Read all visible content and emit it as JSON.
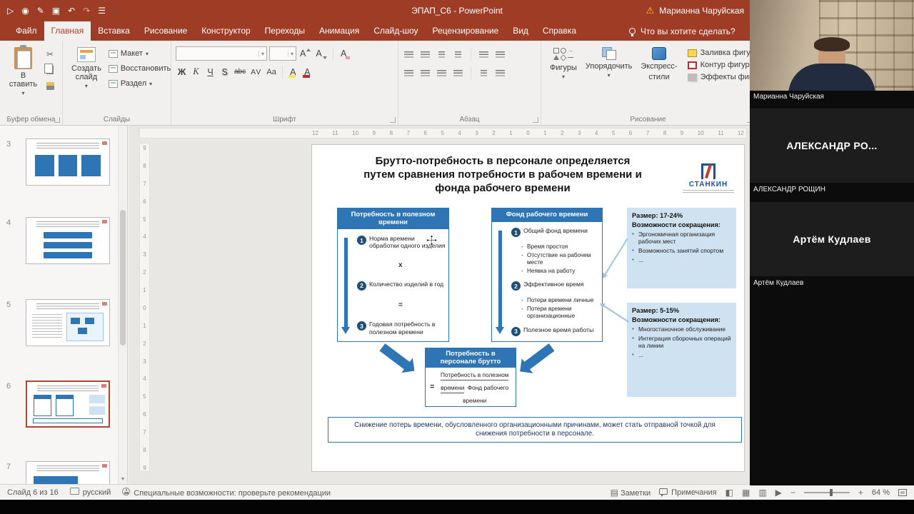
{
  "colors": {
    "ppt_red": "#9e3c26",
    "accent_blue": "#2e75b6",
    "dark_blue": "#1f4e79",
    "light_blue_fill": "#cfe2f1",
    "selected_thumb_border": "#b3432b",
    "warning_yellow": "#f6c61e"
  },
  "icons": {
    "caret": "▾",
    "scissors": "✂",
    "undo": "↶",
    "redo": "↷",
    "save": "▣",
    "slideshow": "▷",
    "touch": "◉",
    "pen": "✎",
    "menu": "☰",
    "warning": "⚠",
    "notes": "▤",
    "normal_view": "◧",
    "grid_view": "▦",
    "reading_view": "▥",
    "slideshow_view": "▶",
    "zoom_out": "−",
    "zoom_in": "+",
    "down_arrow": "▼"
  },
  "titlebar": {
    "title": "ЭПАП_С6 - PowerPoint",
    "account_name": "Марианна Чаруйская"
  },
  "tabs": {
    "file": "Файл",
    "active": "Главная",
    "rest": [
      "Вставка",
      "Рисование",
      "Конструктор",
      "Переходы",
      "Анимация",
      "Слайд-шоу",
      "Рецензирование",
      "Вид",
      "Справка"
    ],
    "tellme": "Что вы хотите сделать?"
  },
  "ribbon": {
    "paste": "В ставить",
    "new_slide": "Создать слайд",
    "layout": "Макет",
    "reset": "Восстановить",
    "section": "Раздел",
    "font": {
      "grow": "А",
      "shrink": "А",
      "clear": "А",
      "bold": "Ж",
      "italic": "К",
      "underline": "Ч",
      "shadow": "S",
      "strikethrough": "abc",
      "spacing": "AV",
      "case": "Aa",
      "highlight": "А",
      "color": "А"
    },
    "shapes": "Фигуры",
    "arrange": "Упорядочить",
    "quick_styles_1": "Экспресс-",
    "quick_styles_2": "стили",
    "shape_fill": "Заливка фигуры",
    "shape_outline": "Контур фигуры",
    "shape_effects": "Эффекты фигур",
    "groups": [
      "Буфер обмена",
      "Слайды",
      "Шрифт",
      "Абзац",
      "Рисование"
    ]
  },
  "thumbs": [
    {
      "num": "3"
    },
    {
      "num": "4"
    },
    {
      "num": "5"
    },
    {
      "num": "6"
    },
    {
      "num": "7"
    }
  ],
  "editor": {
    "hruler": [
      "12",
      "11",
      "10",
      "9",
      "8",
      "7",
      "6",
      "5",
      "4",
      "3",
      "2",
      "1",
      "0",
      "1",
      "2",
      "3",
      "4",
      "5",
      "6",
      "7",
      "8",
      "9",
      "10",
      "11",
      "12"
    ],
    "vruler": [
      "9",
      "8",
      "7",
      "6",
      "5",
      "4",
      "3",
      "2",
      "1",
      "0",
      "1",
      "2",
      "3",
      "4",
      "5",
      "6",
      "7",
      "8",
      "9"
    ]
  },
  "slide": {
    "title_lines": [
      "Брутто-потребность в персонале определяется",
      "путем сравнения потребности в рабочем времени и",
      "фонда рабочего времени"
    ],
    "logo_text": "СТАНКИН",
    "left_box": {
      "header": "Потребность в полезном времени",
      "steps": [
        {
          "num": "1",
          "text": "Норма времени обработки одного изделия"
        },
        {
          "num": "2",
          "text": "Количество изделий в год"
        },
        {
          "num": "3",
          "text": "Годовая потребность в полезном времени"
        }
      ],
      "multiply": "х",
      "equals": "="
    },
    "middle_box": {
      "header": "Фонд рабочего времени",
      "step1": {
        "num": "1",
        "text": "Общий фонд времени"
      },
      "deductions1": [
        "Время простоя",
        "Отсутствие на рабочем месте",
        "Неявка на работу"
      ],
      "step2": {
        "num": "2",
        "text": "Эффективное время"
      },
      "deductions2": [
        "Потери времени личные",
        "Потери времени организационные"
      ],
      "step3": {
        "num": "3",
        "text": "Полезное время работы"
      }
    },
    "info_boxes": [
      {
        "size": "Размер: 17-24%",
        "title": "Возможности сокращения:",
        "items": [
          "Эргономичная организация рабочих мест",
          "Возможность занятий спортом",
          "..."
        ]
      },
      {
        "size": "Размер: 5-15%",
        "title": "Возможности сокращения:",
        "items": [
          "Многостаночное обслуживание",
          "Интеграция сборочных операций на линии",
          "..."
        ]
      }
    ],
    "result_box": {
      "header": "Потребность в персонале брутто",
      "equals": "=",
      "numerator": "Потребность в полезном времени",
      "denominator": "Фонд рабочего времени"
    },
    "footnote": "Снижение потерь времени, обусловленного организационными причинами, может стать отправной точкой для снижения потребности в персонале."
  },
  "statusbar": {
    "slide_counter": "Слайд 6 из 16",
    "language": "русский",
    "accessibility": "Специальные возможности: проверьте рекомендации",
    "notes": "Заметки",
    "comments": "Примечания",
    "zoom": "64 %"
  },
  "call": {
    "participants": [
      {
        "label": "Марианна Чаруйская"
      },
      {
        "tile_text": "АЛЕКСАНДР РО...",
        "label": "АЛЕКСАНДР РОЩИН"
      },
      {
        "tile_text": "Артём Кудлаев",
        "label": "Артём Кудлаев"
      }
    ]
  }
}
